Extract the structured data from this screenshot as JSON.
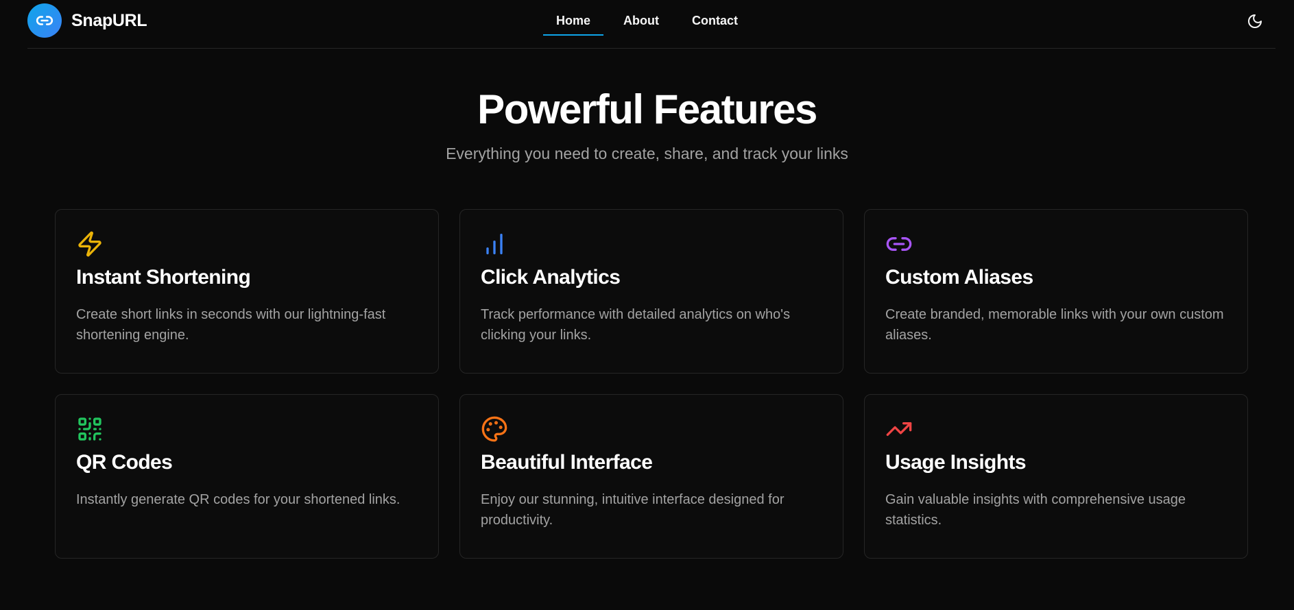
{
  "brand": {
    "name": "SnapURL",
    "logo_icon": "link-icon",
    "accent": "#0ea5e9"
  },
  "nav": {
    "items": [
      {
        "label": "Home",
        "active": true
      },
      {
        "label": "About",
        "active": false
      },
      {
        "label": "Contact",
        "active": false
      }
    ],
    "theme_toggle_icon": "moon-icon"
  },
  "hero": {
    "title": "Powerful Features",
    "subtitle": "Everything you need to create, share, and track your links"
  },
  "features": [
    {
      "icon": "lightning-icon",
      "color": "#eab308",
      "title": "Instant Shortening",
      "description": "Create short links in seconds with our lightning-fast shortening engine."
    },
    {
      "icon": "bar-chart-icon",
      "color": "#3b82f6",
      "title": "Click Analytics",
      "description": "Track performance with detailed analytics on who's clicking your links."
    },
    {
      "icon": "link-icon",
      "color": "#a855f7",
      "title": "Custom Aliases",
      "description": "Create branded, memorable links with your own custom aliases."
    },
    {
      "icon": "qr-code-icon",
      "color": "#22c55e",
      "title": "QR Codes",
      "description": "Instantly generate QR codes for your shortened links."
    },
    {
      "icon": "palette-icon",
      "color": "#f97316",
      "title": "Beautiful Interface",
      "description": "Enjoy our stunning, intuitive interface designed for productivity."
    },
    {
      "icon": "trending-up-icon",
      "color": "#ef4444",
      "title": "Usage Insights",
      "description": "Gain valuable insights with comprehensive usage statistics."
    }
  ]
}
